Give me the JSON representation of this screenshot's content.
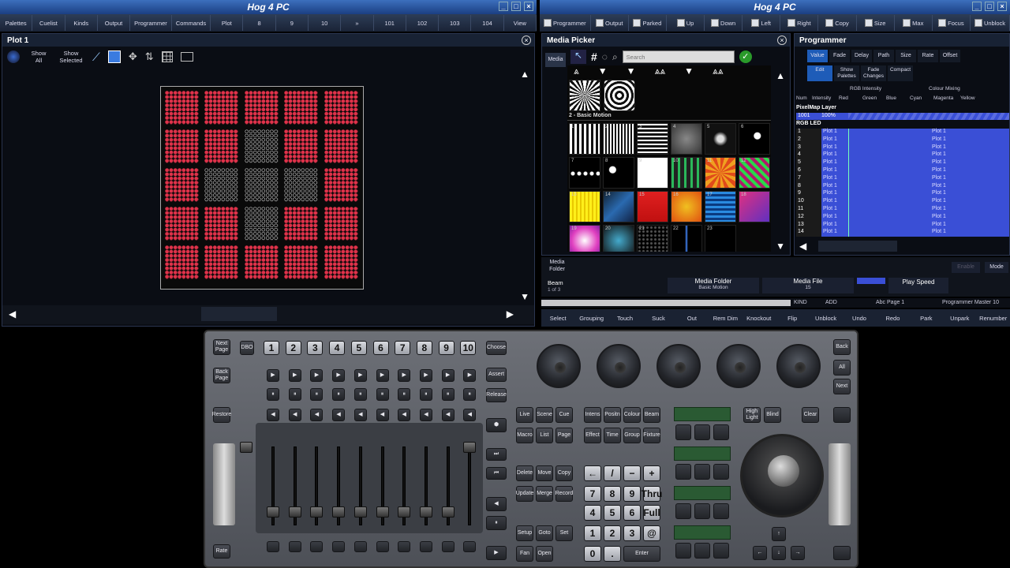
{
  "left_window": {
    "title": "Hog 4 PC",
    "toolbar": [
      "Palettes",
      "Cuelist",
      "Kinds",
      "Output",
      "Programmer",
      "Commands",
      "Plot",
      "8",
      "9",
      "10",
      "»",
      "101",
      "102",
      "103",
      "104",
      "View"
    ]
  },
  "plot": {
    "title": "Plot 1",
    "tools": [
      "Show All",
      "Show Selected"
    ]
  },
  "right_window": {
    "title": "Hog 4 PC",
    "toolbar": [
      "Programmer",
      "Output",
      "Parked",
      "Up",
      "Down",
      "Left",
      "Right",
      "Copy",
      "Size",
      "Max",
      "Focus",
      "Unblock"
    ]
  },
  "media_picker": {
    "title": "Media Picker",
    "tab": "Media",
    "search_placeholder": "Search",
    "section_label": "2 - Basic Motion",
    "thumb_numbers": [
      "1",
      "2",
      "3",
      "4",
      "5",
      "6",
      "7",
      "8",
      "9",
      "10",
      "11",
      "12",
      "13",
      "14",
      "15",
      "16",
      "17",
      "18",
      "19",
      "20",
      "21",
      "22",
      "23"
    ]
  },
  "programmer": {
    "title": "Programmer",
    "row1": [
      "Value",
      "Fade",
      "Delay",
      "Path",
      "Size",
      "Rate",
      "Offset"
    ],
    "row2": [
      "Edit",
      "Show Palettes",
      "Fade Changes",
      "Compact"
    ],
    "col_groups": [
      "RGB Intensity",
      "Colour Mixing"
    ],
    "columns": [
      "Num",
      "Intensity",
      "Red",
      "Green",
      "Blue",
      "Cyan",
      "Magenta",
      "Yellow"
    ],
    "layer_label": "PixelMap Layer",
    "layer_num": "1001",
    "layer_value": "100%",
    "group_label": "RGB LED",
    "rows": [
      "1",
      "2",
      "3",
      "4",
      "5",
      "6",
      "7",
      "8",
      "9",
      "10",
      "11",
      "12",
      "13",
      "14"
    ],
    "row_value": "Plot 1"
  },
  "info_bar": {
    "folder_btn": "Media Folder",
    "beam_label": "Beam",
    "beam_page": "1 of 3",
    "media_folder_label": "Media Folder",
    "media_folder_value": "Basic Motion",
    "media_file_label": "Media File",
    "media_file_value": "15",
    "play_speed_label": "Play Speed",
    "enable": "Enable",
    "mode": "Mode"
  },
  "command_line": {
    "kind": "KIND",
    "add": "ADD",
    "page": "Abc Page 1",
    "master": "Programmer Master 10"
  },
  "bottom_toolbar": [
    "Select",
    "Grouping",
    "Touch",
    "Suck",
    "Out",
    "Rem Dim",
    "Knockout",
    "Flip",
    "Unblock",
    "Undo",
    "Redo",
    "Park",
    "Unpark",
    "Renumber"
  ],
  "console": {
    "left_buttons": [
      "Next Page",
      "DBO",
      "Back Page",
      "Restore",
      "Rate"
    ],
    "master_numbers": [
      "1",
      "2",
      "3",
      "4",
      "5",
      "6",
      "7",
      "8",
      "9",
      "10"
    ],
    "right_side": [
      "Choose",
      "Assert",
      "Release"
    ],
    "view_keys": [
      "Live",
      "Scene",
      "Cue",
      "Macro",
      "List",
      "Page"
    ],
    "kind_keys": [
      "Intens",
      "Positn",
      "Colour",
      "Beam",
      "Effect",
      "Time",
      "Group",
      "Fixture"
    ],
    "edit_keys": [
      "Delete",
      "Move",
      "Copy",
      "Update",
      "Merge",
      "Record"
    ],
    "setup_keys": [
      "Setup",
      "Goto",
      "Set",
      "Fan",
      "Open"
    ],
    "keypad": [
      "←",
      "/",
      "−",
      "+",
      "7",
      "8",
      "9",
      "Thru",
      "4",
      "5",
      "6",
      "Full",
      "1",
      "2",
      "3",
      "@",
      "0",
      ".",
      "Enter"
    ],
    "right_keys": [
      "High Light",
      "Blind",
      "Clear",
      "Back",
      "All",
      "Next"
    ]
  }
}
